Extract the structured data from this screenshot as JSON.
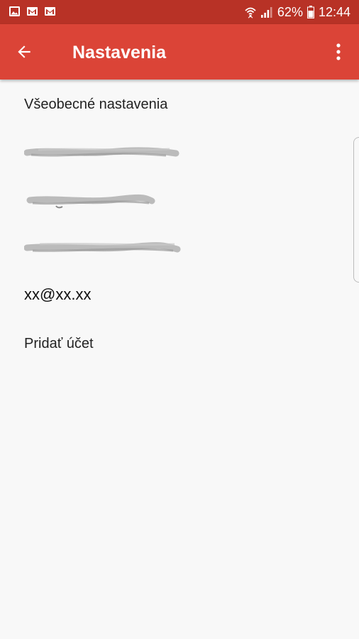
{
  "status_bar": {
    "icons_left": [
      "image-icon",
      "gmail-icon",
      "gmail-icon"
    ],
    "battery_percent": "62%",
    "time": "12:44"
  },
  "app_bar": {
    "title": "Nastavenia",
    "back_icon": "arrow-back-icon",
    "menu_icon": "more-vert-icon",
    "color": "#db4437"
  },
  "settings": {
    "general": "Všeobecné nastavenia",
    "redacted_accounts": 3,
    "email": "xx@xx.xx",
    "add_account": "Pridať účet"
  },
  "colors": {
    "status_bar": "#b83226",
    "app_bar": "#db4437",
    "background": "#f8f8f8"
  }
}
